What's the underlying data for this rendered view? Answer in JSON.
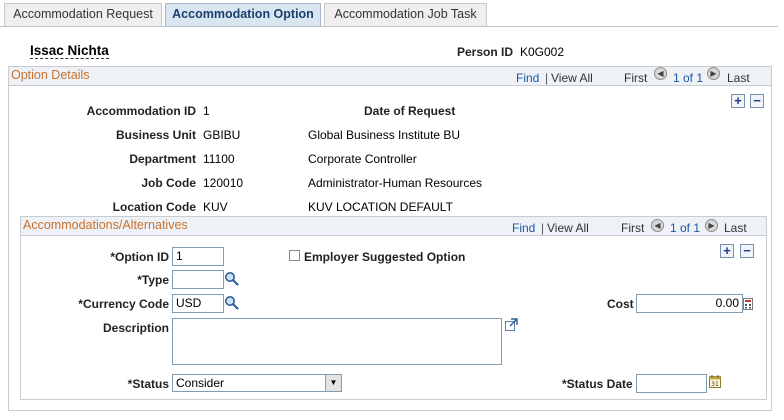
{
  "tabs": [
    {
      "label": "Accommodation Request"
    },
    {
      "label": "Accommodation Option"
    },
    {
      "label": "Accommodation Job Task"
    }
  ],
  "header": {
    "person_name": "Issac Nichta",
    "person_id_label": "Person ID",
    "person_id": "K0G002"
  },
  "option_details": {
    "title": "Option Details",
    "find": "Find",
    "view_all": "View All",
    "sep": "|",
    "first": "First",
    "page_info": "1 of 1",
    "last": "Last",
    "fields": {
      "accommodation_id_label": "Accommodation ID",
      "accommodation_id": "1",
      "date_of_request_label": "Date of Request",
      "business_unit_label": "Business Unit",
      "business_unit": "GBIBU",
      "business_unit_desc": "Global Business Institute BU",
      "department_label": "Department",
      "department": "11100",
      "department_desc": "Corporate Controller",
      "job_code_label": "Job Code",
      "job_code": "120010",
      "job_code_desc": "Administrator-Human Resources",
      "location_code_label": "Location Code",
      "location_code": "KUV",
      "location_code_desc": "KUV LOCATION DEFAULT"
    }
  },
  "alternatives": {
    "title": "Accommodations/Alternatives",
    "find": "Find",
    "view_all": "View All",
    "sep": "|",
    "first": "First",
    "page_info": "1 of 1",
    "last": "Last",
    "option_id_label": "*Option ID",
    "option_id": "1",
    "employer_suggested_label": "Employer Suggested Option",
    "employer_suggested_checked": false,
    "type_label": "*Type",
    "type_value": "",
    "currency_code_label": "*Currency Code",
    "currency_code": "USD",
    "cost_label": "Cost",
    "cost": "0.00",
    "description_label": "Description",
    "description": "",
    "status_label": "*Status",
    "status": "Consider",
    "status_date_label": "*Status Date",
    "status_date": ""
  },
  "icons": {
    "add": "+",
    "remove": "−",
    "prev": "◀",
    "next": "▶",
    "dropdown": "▼"
  },
  "colors": {
    "section_title": "#c8712e",
    "link": "#1a57a8",
    "active_tab_bg": "#d9e6f2"
  }
}
